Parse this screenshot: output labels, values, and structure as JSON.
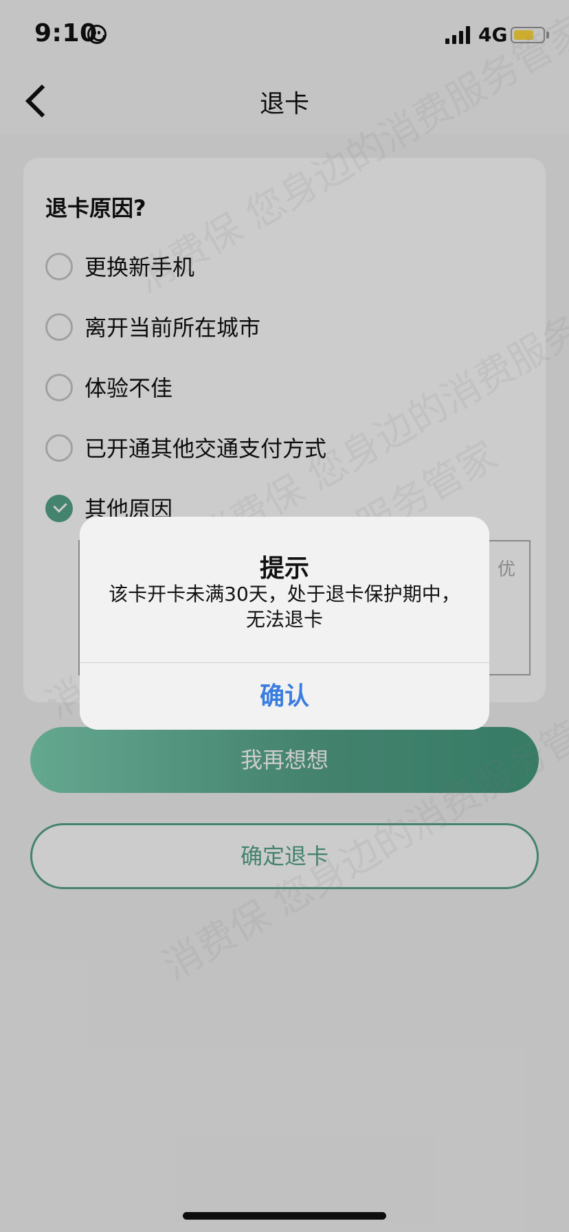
{
  "status_bar": {
    "time": "9:10",
    "network": "4G",
    "battery_level": 0.7
  },
  "nav": {
    "title": "退卡"
  },
  "form": {
    "question": "退卡原因?",
    "options": [
      {
        "label": "更换新手机",
        "checked": false
      },
      {
        "label": "离开当前所在城市",
        "checked": false
      },
      {
        "label": "体验不佳",
        "checked": false
      },
      {
        "label": "已开通其他交通支付方式",
        "checked": false
      },
      {
        "label": "其他原因",
        "checked": true
      }
    ],
    "textarea_visible_text": "优"
  },
  "buttons": {
    "reconsider": "我再想想",
    "confirm_return": "确定退卡"
  },
  "dialog": {
    "title": "提示",
    "message": "该卡开卡未满30天，处于退卡保护期中，无法退卡",
    "confirm": "确认"
  },
  "watermark": {
    "text": "消费保 您身边的消费服务管家"
  },
  "colors": {
    "accent_green": "#55a48a",
    "dialog_button_blue": "#3a7de0",
    "battery_yellow": "#ffd93d"
  }
}
